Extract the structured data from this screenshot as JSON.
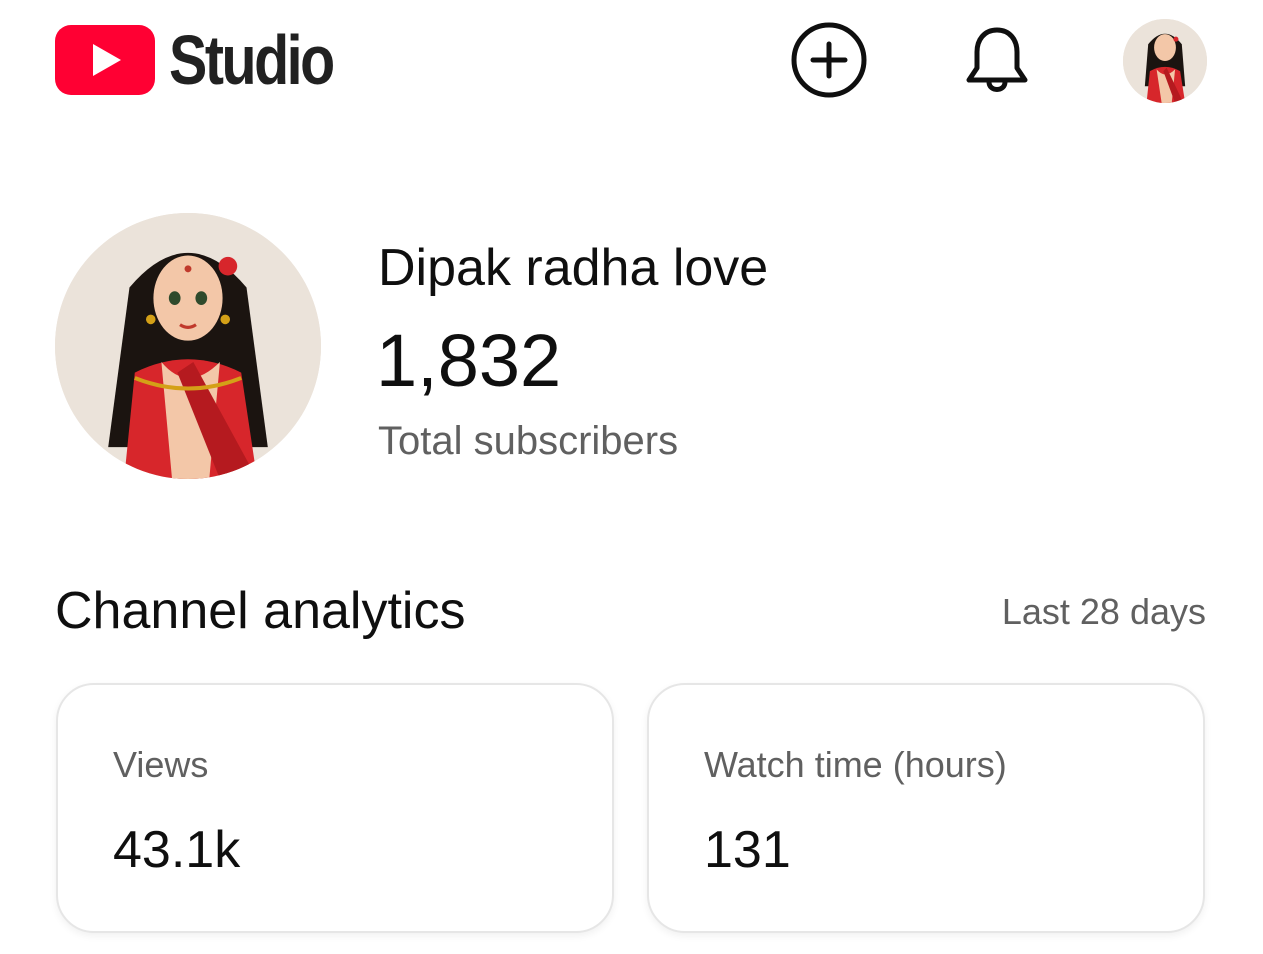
{
  "app": {
    "brand_text": "Studio",
    "brand_color": "#ff0033"
  },
  "header": {
    "icons": [
      "youtube-play-icon",
      "create-plus-icon",
      "notification-bell-icon",
      "account-avatar"
    ]
  },
  "channel": {
    "name": "Dipak radha love",
    "subscriber_count": "1,832",
    "subscriber_label": "Total subscribers"
  },
  "analytics": {
    "title": "Channel analytics",
    "period": "Last 28 days",
    "cards": [
      {
        "label": "Views",
        "value": "43.1k"
      },
      {
        "label": "Watch time (hours)",
        "value": "131"
      }
    ]
  },
  "colors": {
    "text_primary": "#0f0f0f",
    "text_secondary": "#606060",
    "card_border": "#e6e6e6"
  }
}
